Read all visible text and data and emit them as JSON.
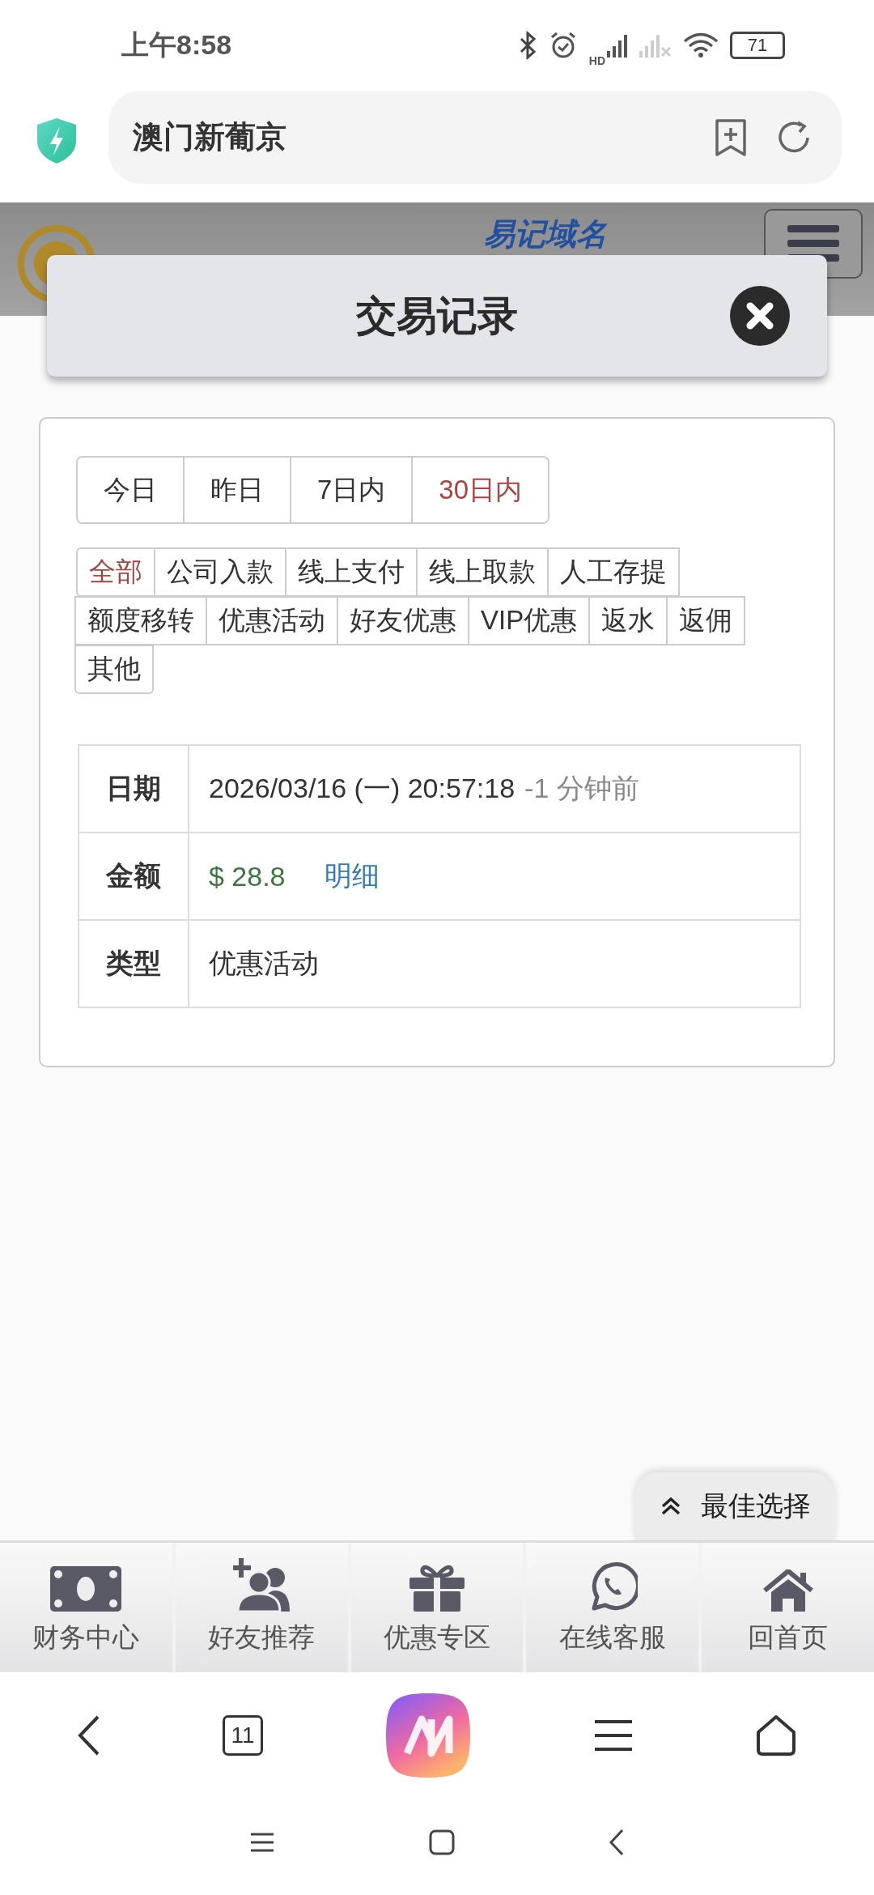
{
  "status_bar": {
    "time": "上午8:58",
    "network_label": "HD",
    "battery": "71"
  },
  "address_bar": {
    "title": "澳门新葡京"
  },
  "site_header": {
    "tagline": "易记域名"
  },
  "modal": {
    "title": "交易记录"
  },
  "date_tabs": [
    {
      "label": "今日",
      "selected": false
    },
    {
      "label": "昨日",
      "selected": false
    },
    {
      "label": "7日内",
      "selected": false
    },
    {
      "label": "30日内",
      "selected": true
    }
  ],
  "category_tags": [
    {
      "label": "全部",
      "selected": true
    },
    {
      "label": "公司入款",
      "selected": false
    },
    {
      "label": "线上支付",
      "selected": false
    },
    {
      "label": "线上取款",
      "selected": false
    },
    {
      "label": "人工存提",
      "selected": false
    },
    {
      "label": "额度移转",
      "selected": false
    },
    {
      "label": "优惠活动",
      "selected": false
    },
    {
      "label": "好友优惠",
      "selected": false
    },
    {
      "label": "VIP优惠",
      "selected": false
    },
    {
      "label": "返水",
      "selected": false
    },
    {
      "label": "返佣",
      "selected": false
    },
    {
      "label": "其他",
      "selected": false
    }
  ],
  "record": [
    {
      "label": "日期",
      "kind": "date",
      "value": "2026/03/16 (一) 20:57:18",
      "note": "-1 分钟前"
    },
    {
      "label": "金额",
      "kind": "amount",
      "value": "$ 28.8",
      "link": "明细"
    },
    {
      "label": "类型",
      "kind": "text",
      "value": "优惠活动"
    }
  ],
  "float_button": {
    "label": "最佳选择"
  },
  "bottom_nav": [
    {
      "label": "财务中心",
      "kind": "money"
    },
    {
      "label": "好友推荐",
      "kind": "add-user"
    },
    {
      "label": "优惠专区",
      "kind": "gift"
    },
    {
      "label": "在线客服",
      "kind": "chat"
    },
    {
      "label": "回首页",
      "kind": "home"
    }
  ],
  "browser_toolbar": {
    "tab_count": "11"
  }
}
